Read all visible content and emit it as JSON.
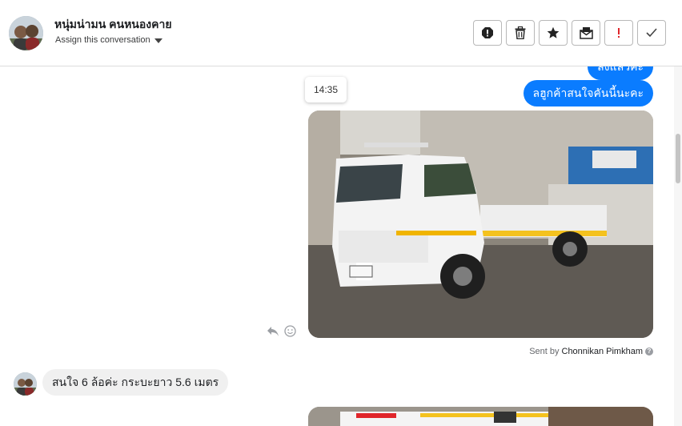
{
  "header": {
    "contact_name": "หนุ่มน่ามน คนหนองคาย",
    "assign_label": "Assign this conversation"
  },
  "toolbar": {
    "buttons": [
      {
        "name": "spam-icon"
      },
      {
        "name": "trash-icon"
      },
      {
        "name": "star-icon"
      },
      {
        "name": "mark-unread-icon"
      },
      {
        "name": "follow-up-icon",
        "color": "#e0262b"
      },
      {
        "name": "done-check-icon"
      }
    ]
  },
  "messages": {
    "prev_outgoing_text": "ส่งแล้วค่ะ",
    "outgoing_text": "ลฮูกค้าสนใจคันนี้นะคะ",
    "timestamp_tooltip": "14:35",
    "sent_by_prefix": "Sent by",
    "sent_by_name": "Chonnikan Pimkham",
    "incoming_text": "สนใจ 6 ล้อค่ะ กระบะยาว 5.6 เมตร"
  },
  "colors": {
    "outgoing_bubble": "#0a7cff",
    "incoming_bubble": "#f0f0f0",
    "accent_red": "#e0262b"
  }
}
